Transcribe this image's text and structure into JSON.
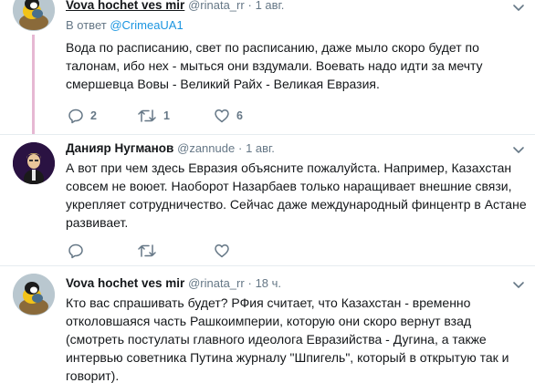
{
  "tweets": [
    {
      "name": "Vova hochet ves mir",
      "handle": "@rinata_rr",
      "separator": "·",
      "time": "1 авг.",
      "reply_prefix": "В ответ",
      "reply_to": "@CrimeaUA1",
      "lines": [
        "Вода по расписанию, свет по расписанию, даже мыло скоро будет по",
        "талонам, ибо нех - мыться они вздумали. Воевать надо идти за мечту",
        "смершевца Вовы - Великий Райх - Великая Евразия."
      ],
      "replies": "2",
      "retweets": "1",
      "likes": "6"
    },
    {
      "name": "Данияр Нугманов",
      "handle": "@zannude",
      "separator": "·",
      "time": "1 авг.",
      "lines": [
        "А вот при чем здесь Евразия объясните пожалуйста. Например, Казахстан",
        "совсем не воюет. Наоборот Назарбаев только наращивает внешние связи,",
        "укрепляет сотрудничество. Сейчас даже международный финцентр в Астане",
        "развивает."
      ],
      "replies": "",
      "retweets": "",
      "likes": ""
    },
    {
      "name": "Vova hochet ves mir",
      "handle": "@rinata_rr",
      "separator": "·",
      "time": "18 ч.",
      "lines": [
        "Кто вас спрашивать будет? РФия считает, что Казахстан - временно",
        "отколовшаяся часть Рашкоимперии, которую они скоро вернут взад",
        "(смотреть постулаты главного идеолога Евразийства - Дугина, а также",
        "интервью советника Путина журналу \"Шпигель\", который в открытую так и",
        "говорит)."
      ]
    }
  ],
  "colors": {
    "thread_line": "#e6b8d3",
    "link": "#1b95e0",
    "muted": "#657786"
  }
}
